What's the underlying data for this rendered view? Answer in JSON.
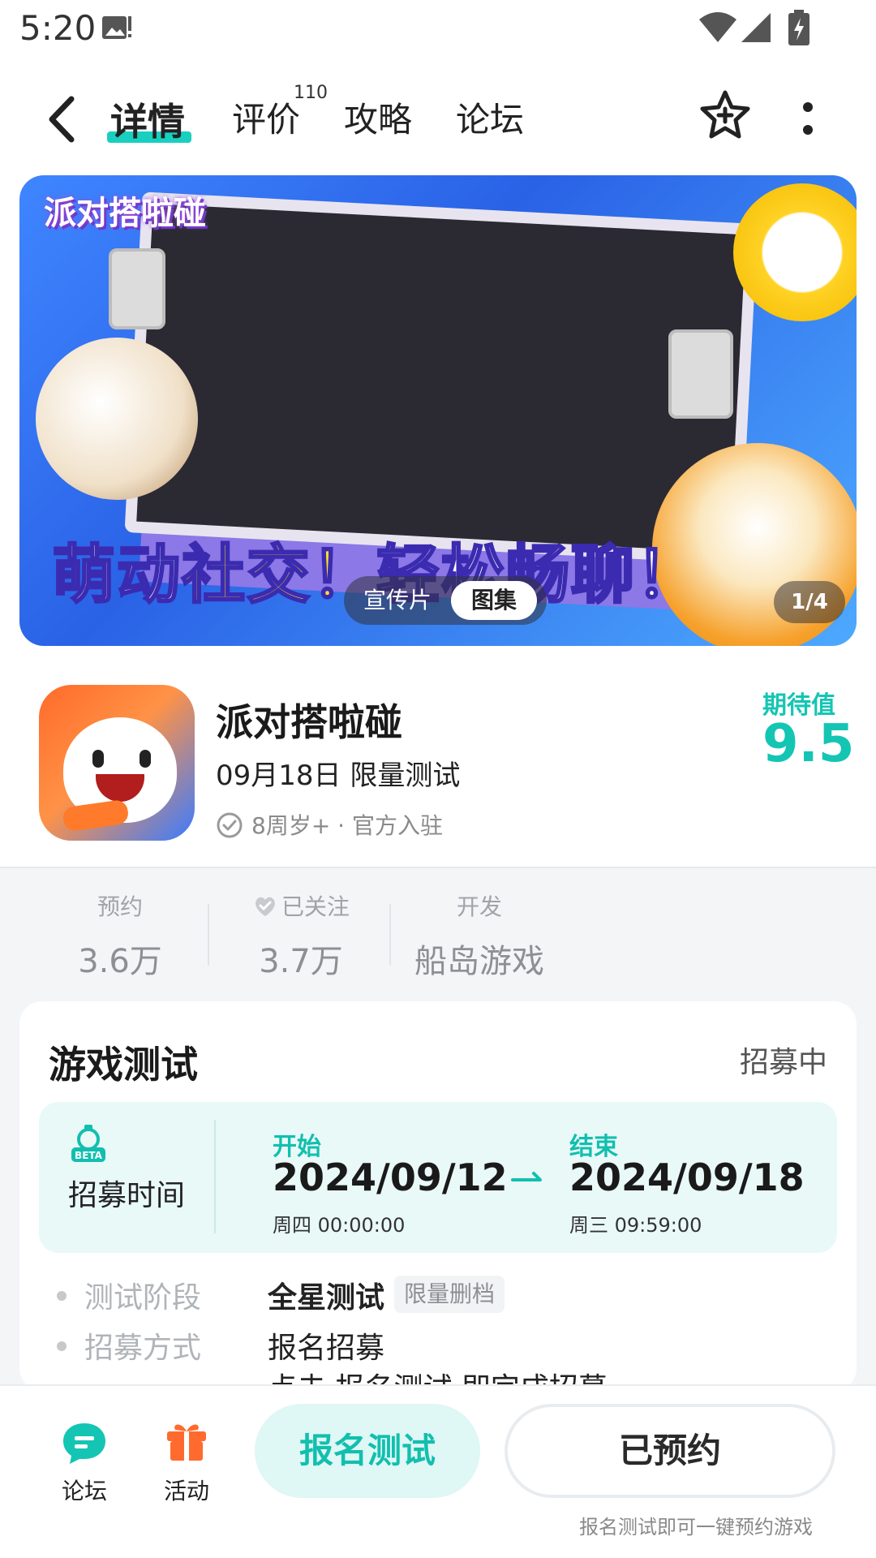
{
  "status_bar": {
    "time": "5:20"
  },
  "nav": {
    "tabs": [
      {
        "label": "详情"
      },
      {
        "label": "评价"
      },
      {
        "label": "攻略"
      },
      {
        "label": "论坛"
      }
    ],
    "review_count": "110"
  },
  "banner": {
    "logo_text": "派对搭啦碰",
    "slogan_part1": "萌动",
    "slogan_part2": "社交！",
    "slogan_part3": "轻松畅聊！",
    "segment": {
      "video": "宣传片",
      "gallery": "图集"
    },
    "pager": "1/4"
  },
  "game": {
    "name": "派对搭啦碰",
    "date": "09月18日 限量测试",
    "meta": "8周岁+ · 官方入驻",
    "expect_label": "期待值",
    "expect_value": "9.5"
  },
  "stats": [
    {
      "label": "预约",
      "value": "3.6万"
    },
    {
      "label": "已关注",
      "value": "3.7万"
    },
    {
      "label": "开发",
      "value": "船岛游戏"
    }
  ],
  "test_card": {
    "title": "游戏测试",
    "status": "招募中",
    "recruit_label": "招募时间",
    "start_label": "开始",
    "start_date": "2024/09/12",
    "start_sub": "周四  00:00:00",
    "end_label": "结束",
    "end_date": "2024/09/18",
    "end_sub": "周三  09:59:00",
    "rows": [
      {
        "label": "测试阶段",
        "value": "全星测试",
        "tag": "限量删档"
      },
      {
        "label": "招募方式",
        "value": "报名招募"
      }
    ],
    "cut_text": "点击 报名测试 即完成招募"
  },
  "bottom_bar": {
    "forum_label": "论坛",
    "activity_label": "活动",
    "signup_label": "报名测试",
    "reserved_label": "已预约",
    "hint": "报名测试即可一键预约游戏"
  },
  "colors": {
    "accent": "#14c5b4",
    "accent_light": "#e9f9f8"
  }
}
